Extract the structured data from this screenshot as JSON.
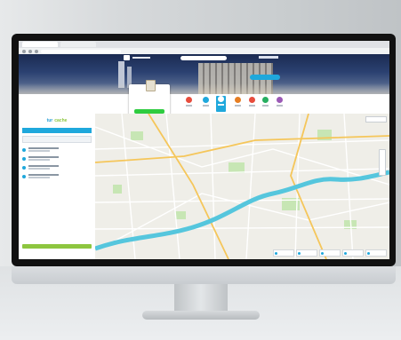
{
  "browser": {
    "tabs": [
      "",
      ""
    ],
    "url": ""
  },
  "header": {
    "logo_text": "",
    "search_placeholder": "",
    "profile_label": ""
  },
  "city_card": {
    "name": "",
    "button_label": ""
  },
  "menu": {
    "items": [
      {
        "icon": "heart-icon",
        "color": "#e74c3c",
        "active": false
      },
      {
        "icon": "house-icon",
        "color": "#1fa8dc",
        "active": false
      },
      {
        "icon": "pin-icon",
        "color": "#1fa8dc",
        "active": true
      },
      {
        "icon": "bag-icon",
        "color": "#e67e22",
        "active": false
      },
      {
        "icon": "star-icon",
        "color": "#e74c3c",
        "active": false
      },
      {
        "icon": "leaf-icon",
        "color": "#27ae60",
        "active": false
      },
      {
        "icon": "info-icon",
        "color": "#9b59b6",
        "active": false
      }
    ]
  },
  "sidebar": {
    "brand_part1": "tur",
    "brand_part2": "cache",
    "header_label": "",
    "search_value": "",
    "entries": [
      "",
      "",
      "",
      ""
    ],
    "footer_label": ""
  },
  "map": {
    "controls_label": "",
    "legend": [
      "",
      "",
      "",
      "",
      ""
    ],
    "colors": {
      "river": "#55c6dd",
      "road_major": "#f5c65a",
      "park": "#c7e6b4"
    }
  }
}
